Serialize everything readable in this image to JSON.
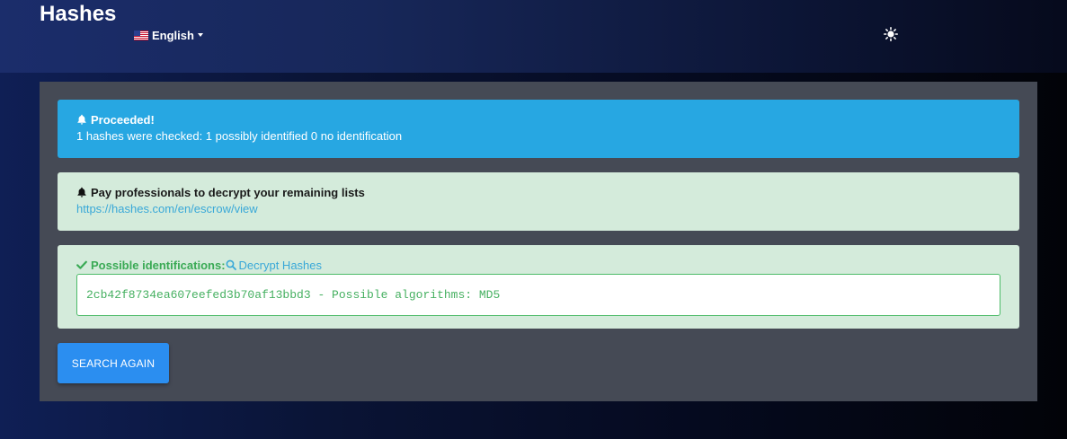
{
  "header": {
    "brand": "Hashes",
    "language": {
      "label": "English",
      "flag_icon": "us-flag-icon"
    },
    "theme_toggle_icon": "sun-icon"
  },
  "alerts": {
    "proceeded": {
      "title": "Proceeded!",
      "message": "1 hashes were checked: 1 possibly identified 0 no identification",
      "icon": "bell-icon",
      "color": "#27a7e2"
    },
    "escrow": {
      "title": "Pay professionals to decrypt your remaining lists",
      "link_text": "https://hashes.com/en/escrow/view",
      "icon": "bell-icon",
      "color": "#d4ebdb"
    },
    "identification": {
      "label": "Possible identifications:",
      "decrypt_link": "Decrypt Hashes",
      "result": "2cb42f8734ea607eefed3b70af13bbd3 - Possible algorithms: MD5",
      "icon": "check-icon",
      "link_icon": "search-icon",
      "color": "#4cbb68"
    }
  },
  "actions": {
    "search_again": "SEARCH AGAIN"
  },
  "colors": {
    "panel": "#454a55",
    "button": "#2b8ef0",
    "link": "#39a8d8"
  }
}
